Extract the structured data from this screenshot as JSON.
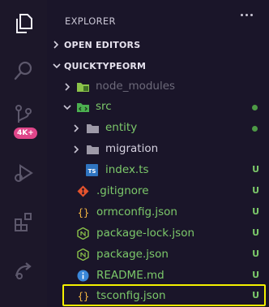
{
  "sidebar": {
    "title": "EXPLORER",
    "more_icon": "ellipsis-icon"
  },
  "sections": {
    "open_editors": "OPEN EDITORS",
    "project": "QUICKTYPEORM"
  },
  "tree": [
    {
      "name": "node_modules",
      "type": "folder",
      "icon": "node-modules-folder-icon",
      "status": ""
    },
    {
      "name": "src",
      "type": "folder",
      "icon": "src-folder-icon",
      "status": "dot"
    },
    {
      "name": "entity",
      "type": "folder",
      "icon": "folder-icon",
      "status": "dot"
    },
    {
      "name": "migration",
      "type": "folder",
      "icon": "folder-icon",
      "status": ""
    },
    {
      "name": "index.ts",
      "type": "file",
      "icon": "typescript-icon",
      "status": "U"
    },
    {
      "name": ".gitignore",
      "type": "file",
      "icon": "git-icon",
      "status": "U"
    },
    {
      "name": "ormconfig.json",
      "type": "file",
      "icon": "json-icon",
      "status": "U"
    },
    {
      "name": "package-lock.json",
      "type": "file",
      "icon": "npm-icon",
      "status": "U"
    },
    {
      "name": "package.json",
      "type": "file",
      "icon": "npm-icon",
      "status": "U"
    },
    {
      "name": "README.md",
      "type": "file",
      "icon": "info-icon",
      "status": "U"
    },
    {
      "name": "tsconfig.json",
      "type": "file",
      "icon": "json-icon",
      "status": "U"
    }
  ],
  "activity_bar": {
    "icons": [
      "files-icon",
      "search-icon",
      "source-control-icon",
      "run-debug-icon",
      "extensions-icon",
      "remote-icon"
    ],
    "badge": "4K+"
  },
  "colors": {
    "background": "#1a1529",
    "untracked": "#7cc96a",
    "ignored": "#6d6a7a",
    "highlight": "#f4f000"
  }
}
